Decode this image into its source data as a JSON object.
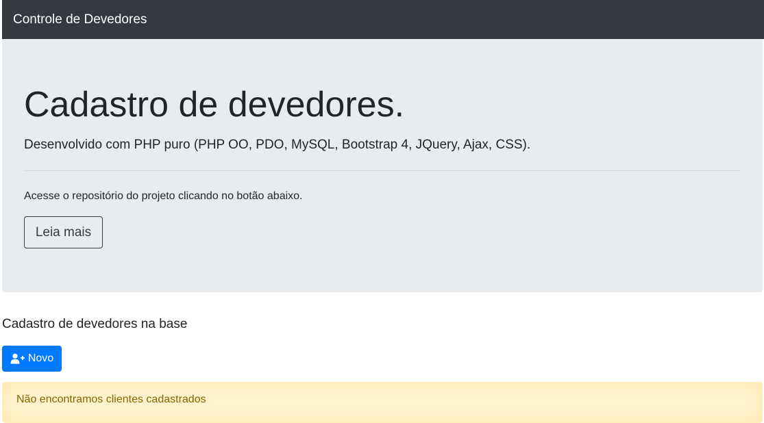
{
  "navbar": {
    "brand": "Controle de Devedores"
  },
  "jumbotron": {
    "title": "Cadastro de devedores.",
    "lead": "Desenvolvido com PHP puro (PHP OO, PDO, MySQL, Bootstrap 4, JQuery, Ajax, CSS).",
    "repo_text": "Acesse o repositório do projeto clicando no botão abaixo.",
    "read_more_label": "Leia mais"
  },
  "section": {
    "title": "Cadastro de devedores na base",
    "new_button": {
      "icon": "user-plus-icon",
      "label": "Novo"
    }
  },
  "alert": {
    "message": "Não encontramos clientes cadastrados"
  },
  "colors": {
    "navbar_bg": "#343a40",
    "jumbotron_bg": "#e9ecef",
    "primary": "#007bff",
    "warning_bg": "#fff3cd",
    "warning_text": "#856404"
  }
}
